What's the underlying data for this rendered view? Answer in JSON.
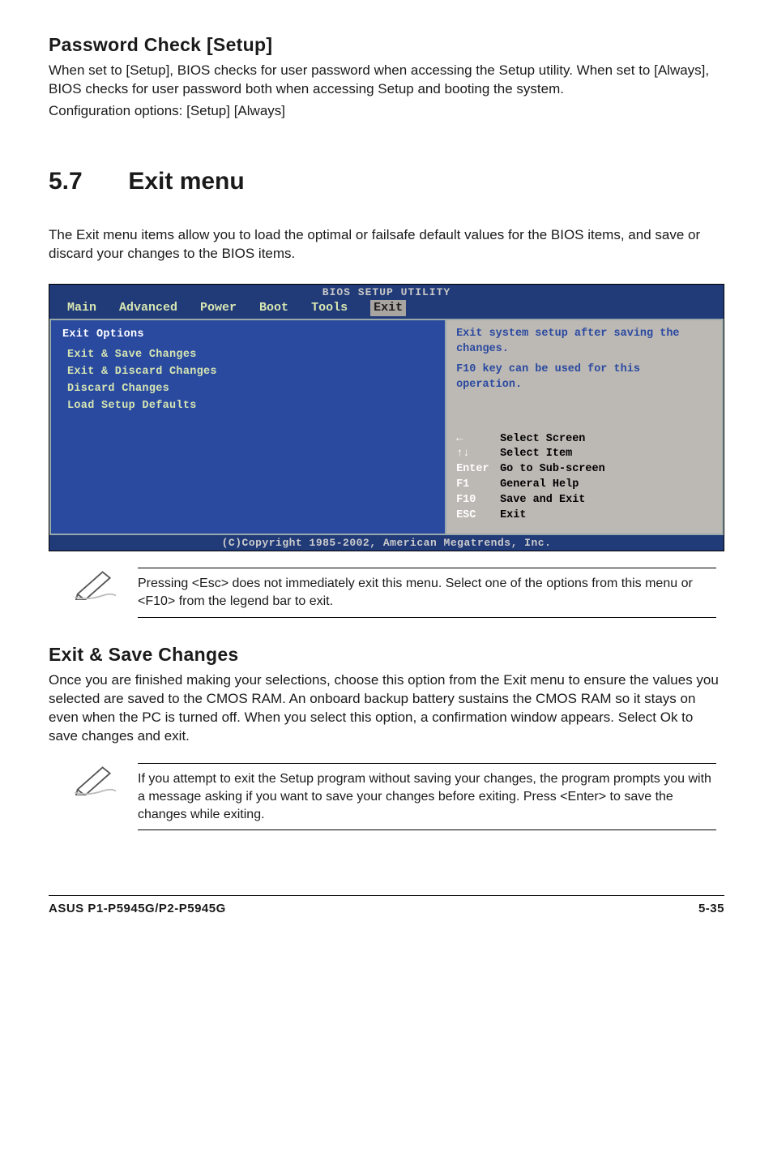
{
  "pwd_check": {
    "heading": "Password Check [Setup]",
    "para": "When set to [Setup], BIOS checks for user password when accessing the Setup utility. When set to [Always], BIOS checks for user password both when accessing Setup and booting the system.",
    "conf": "Configuration options: [Setup] [Always]"
  },
  "section": {
    "num": "5.7",
    "title": "Exit menu",
    "intro": "The Exit menu items allow you to load the optimal or failsafe default values for the BIOS items, and save or discard your changes to the BIOS items."
  },
  "bios": {
    "util_title": "BIOS SETUP UTILITY",
    "tabs": [
      "Main",
      "Advanced",
      "Power",
      "Boot",
      "Tools",
      "Exit"
    ],
    "active_tab": "Exit",
    "left": {
      "heading": "Exit Options",
      "items": [
        "Exit & Save Changes",
        "Exit & Discard Changes",
        "Discard Changes",
        "",
        "Load Setup Defaults"
      ]
    },
    "right": {
      "help1": "Exit system setup after saving the changes.",
      "help2": "F10 key can be used for this operation.",
      "legend": [
        {
          "key": "←",
          "txt": "Select Screen"
        },
        {
          "key": "↑↓",
          "txt": "Select Item"
        },
        {
          "key": "Enter",
          "txt": "Go to Sub-screen"
        },
        {
          "key": "F1",
          "txt": "General Help"
        },
        {
          "key": "F10",
          "txt": "Save and Exit"
        },
        {
          "key": "ESC",
          "txt": "Exit"
        }
      ]
    },
    "copyright": "(C)Copyright 1985-2002, American Megatrends, Inc."
  },
  "note1": "Pressing <Esc> does not immediately exit this menu. Select one of the options from this menu or <F10> from the legend bar to exit.",
  "exit_save": {
    "heading": "Exit & Save Changes",
    "para": "Once you are finished making your selections, choose this option from the Exit menu to ensure the values you selected are saved to the CMOS RAM. An onboard backup battery sustains the CMOS RAM so it stays on even when the PC is turned off. When you select this option, a confirmation window appears. Select Ok to save changes and exit."
  },
  "note2": " If you attempt to exit the Setup program without saving your changes, the program prompts you with a message asking if you want to save your changes before exiting. Press <Enter>  to save the  changes while exiting.",
  "footer": {
    "left": "ASUS P1-P5945G/P2-P5945G",
    "right": "5-35"
  }
}
